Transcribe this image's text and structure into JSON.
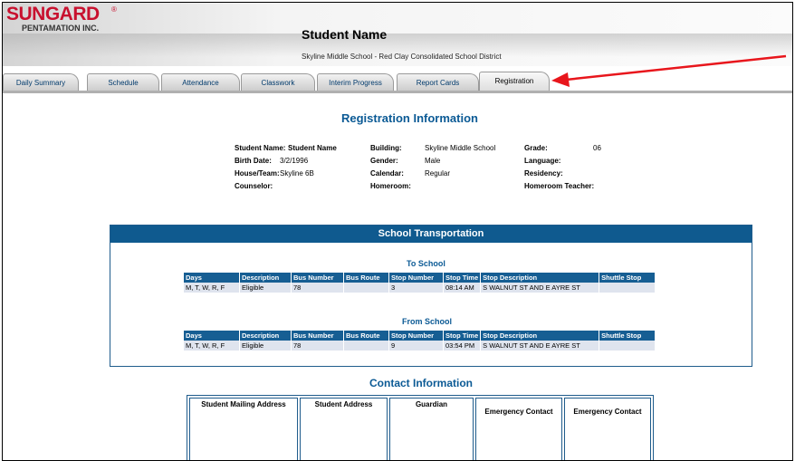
{
  "header": {
    "logo_main": "SUNGARD",
    "logo_reg": "®",
    "logo_sub": "PENTAMATION INC.",
    "student_name": "Student Name",
    "school_line": "Skyline Middle School - Red Clay Consolidated School District"
  },
  "tabs": [
    {
      "label": "Daily Summary"
    },
    {
      "label": "Schedule"
    },
    {
      "label": "Attendance"
    },
    {
      "label": "Classwork"
    },
    {
      "label": "Interim Progress"
    },
    {
      "label": "Report Cards"
    },
    {
      "label": "Registration",
      "active": true
    }
  ],
  "registration": {
    "title": "Registration Information",
    "student_name_label": "Student Name:",
    "student_name_value": "Student Name",
    "birth_date_label": "Birth Date:",
    "birth_date_value": "3/2/1996",
    "house_team_label": "House/Team:",
    "house_team_value": "Skyline 6B",
    "counselor_label": "Counselor:",
    "building_label": "Building:",
    "building_value": "Skyline Middle School",
    "gender_label": "Gender:",
    "gender_value": "Male",
    "calendar_label": "Calendar:",
    "calendar_value": "Regular",
    "homeroom_label": "Homeroom:",
    "grade_label": "Grade:",
    "grade_value": "06",
    "language_label": "Language:",
    "residency_label": "Residency:",
    "homeroom_teacher_label": "Homeroom Teacher:"
  },
  "transportation": {
    "title": "School Transportation",
    "columns": [
      "Days",
      "Description",
      "Bus Number",
      "Bus Route",
      "Stop Number",
      "Stop Time",
      "Stop Description",
      "Shuttle Stop"
    ],
    "to_school": {
      "title": "To School",
      "row": [
        "M, T, W, R, F",
        "Eligible",
        "78",
        "",
        "3",
        "08:14 AM",
        "S WALNUT ST AND E AYRE ST",
        ""
      ]
    },
    "from_school": {
      "title": "From School",
      "row": [
        "M, T, W, R, F",
        "Eligible",
        "78",
        "",
        "9",
        "03:54 PM",
        "S WALNUT ST AND E AYRE ST",
        ""
      ]
    }
  },
  "contact": {
    "title": "Contact Information",
    "columns": [
      "Student Mailing Address",
      "Student Address",
      "Guardian",
      "Emergency Contact",
      "Emergency Contact"
    ]
  },
  "colors": {
    "brand_red": "#c8102e",
    "header_blue": "#0f5a8f",
    "title_blue": "#0b5a95",
    "row_bg": "#dfe4ee",
    "annotation_red": "#e8161c"
  }
}
